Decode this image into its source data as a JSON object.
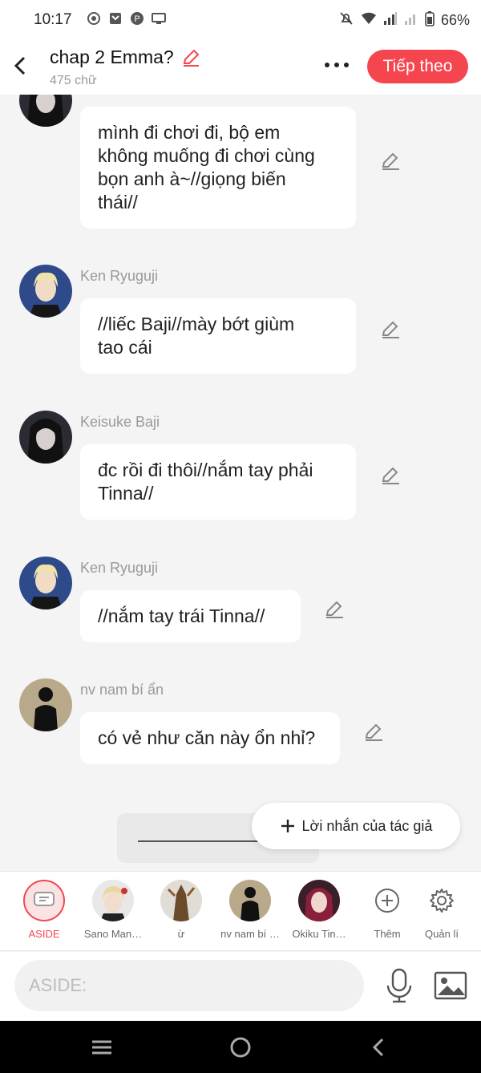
{
  "status": {
    "time": "10:17",
    "battery": "66%"
  },
  "header": {
    "title": "chap 2 Emma?",
    "word_count": "475 chữ",
    "next_label": "Tiếp theo"
  },
  "messages": [
    {
      "sender": "",
      "lines": [
        "mình đi chơi đi, bộ em",
        "không muống đi chơi cùng",
        "bọn anh à~//giọng biến",
        "thái//"
      ]
    },
    {
      "sender": "Ken Ryuguji",
      "lines": [
        "//liếc Baji//mày bớt giùm",
        "tao cái"
      ]
    },
    {
      "sender": "Keisuke Baji",
      "lines": [
        "đc rồi đi thôi//nắm tay phải",
        "Tinna//"
      ]
    },
    {
      "sender": "Ken Ryuguji",
      "lines": [
        "//nắm tay trái Tinna//"
      ]
    },
    {
      "sender": "nv nam bí ẩn",
      "lines": [
        "có vẻ như căn này ổn nhỉ?"
      ]
    }
  ],
  "author_note_label": "Lời nhắn của tác giả",
  "characters": [
    {
      "label": "ASIDE"
    },
    {
      "label": "Sano Man…"
    },
    {
      "label": "ừ"
    },
    {
      "label": "nv nam bí …"
    },
    {
      "label": "Okiku Tin…"
    }
  ],
  "char_actions": {
    "add_label": "Thêm",
    "manage_label": "Quản lí"
  },
  "input": {
    "placeholder": "ASIDE:"
  },
  "colors": {
    "accent": "#f5454e",
    "background": "#f4f4f4"
  }
}
